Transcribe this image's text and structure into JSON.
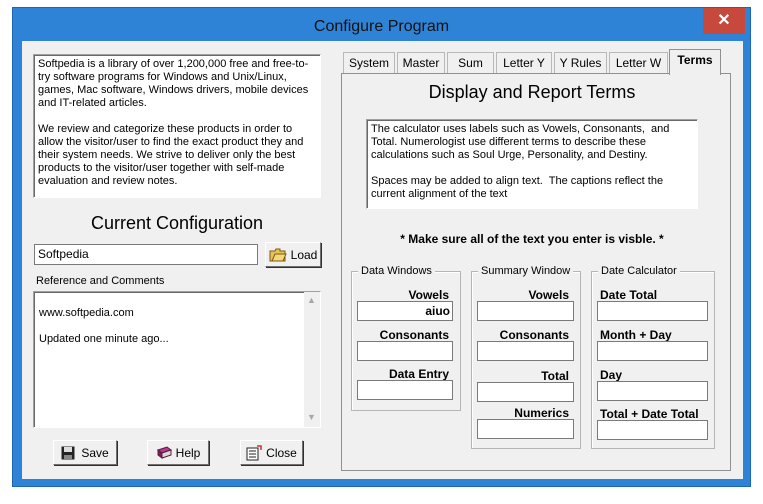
{
  "window": {
    "title": "Configure Program",
    "close_glyph": "✕"
  },
  "left": {
    "description": "Softpedia is a library of over 1,200,000 free and free-to-try software programs for Windows and Unix/Linux, games, Mac software, Windows drivers, mobile devices and IT-related articles.\n\nWe review and categorize these products in order to allow the visitor/user to find the exact product they and their system needs. We strive to deliver only the best products to the visitor/user together with self-made evaluation and review notes.",
    "current_config_heading": "Current Configuration",
    "config_value": "Softpedia",
    "load_label": "Load",
    "ref_label": "Reference and Comments",
    "ref_text": "www.softpedia.com\n\nUpdated one minute ago...",
    "save_label": "Save",
    "help_label": "Help",
    "close_label": "Close"
  },
  "tabs": [
    {
      "label": "System"
    },
    {
      "label": "Master"
    },
    {
      "label": "Sum"
    },
    {
      "label": "Letter Y"
    },
    {
      "label": "Y Rules"
    },
    {
      "label": "Letter W"
    },
    {
      "label": "Terms"
    }
  ],
  "terms": {
    "heading": "Display and Report Terms",
    "info": "The calculator uses labels such as Vowels, Consonants,  and Total. Numerologist use different terms to describe these calculations such as Soul Urge, Personality, and Destiny.\n\nSpaces may be added to align text.  The captions reflect the current alignment of the text",
    "warning": "* Make sure all of the text you enter is visble. *",
    "data_windows": {
      "title": "Data Windows",
      "fields": [
        {
          "label": "Vowels",
          "value": "aiuo"
        },
        {
          "label": "Consonants",
          "value": ""
        },
        {
          "label": "Data Entry",
          "value": ""
        }
      ]
    },
    "summary_window": {
      "title": "Summary Window",
      "fields": [
        {
          "label": "Vowels",
          "value": ""
        },
        {
          "label": "Consonants",
          "value": ""
        },
        {
          "label": "Total",
          "value": ""
        },
        {
          "label": "Numerics",
          "value": ""
        }
      ]
    },
    "date_calculator": {
      "title": "Date Calculator",
      "fields": [
        {
          "label": "Date Total",
          "value": ""
        },
        {
          "label": "Month + Day",
          "value": ""
        },
        {
          "label": "Day",
          "value": ""
        },
        {
          "label": "Total + Date Total",
          "value": ""
        }
      ]
    }
  }
}
